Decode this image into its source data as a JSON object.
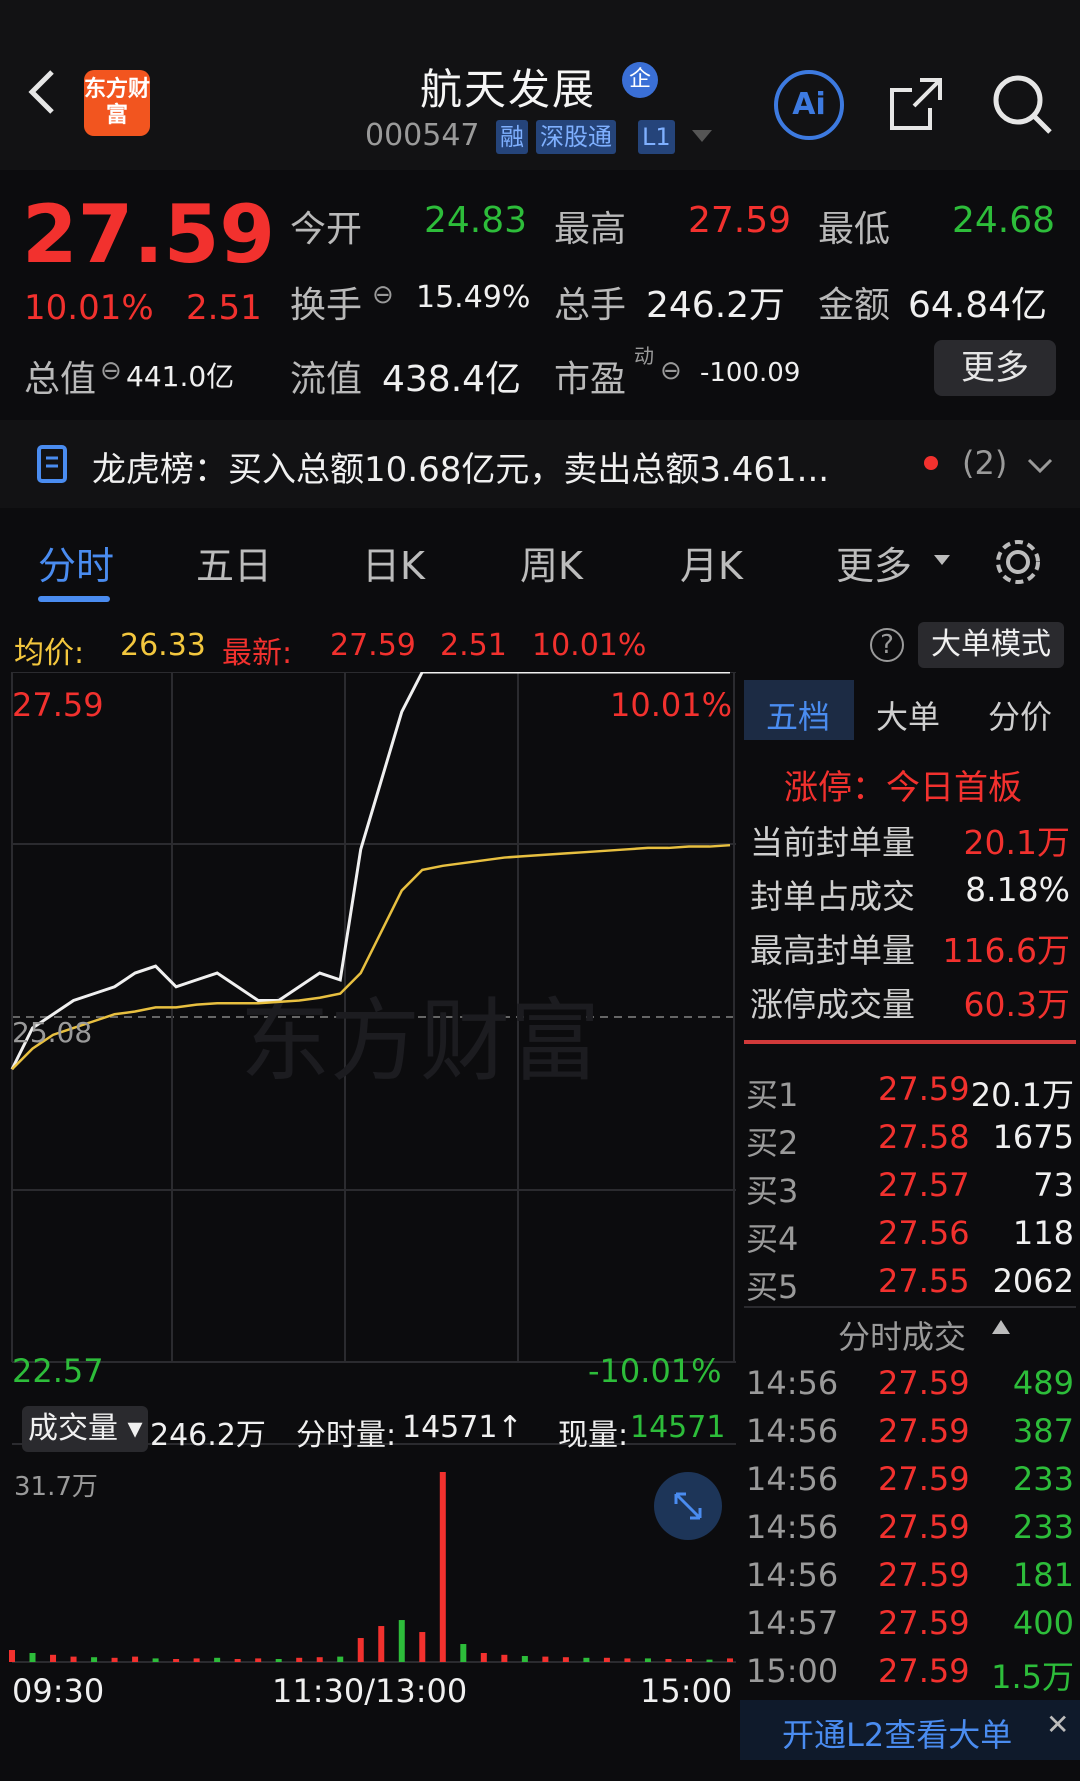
{
  "header": {
    "back_icon": "chevron-left-icon",
    "logo_text": "东方财富",
    "title": "航天发展",
    "qi_badge": "企",
    "code": "000547",
    "tags": [
      "融",
      "深股通",
      "L1"
    ],
    "ai_label": "Ai"
  },
  "quote": {
    "price": "27.59",
    "pct": "10.01%",
    "chg": "2.51",
    "open_label": "今开",
    "open": "24.83",
    "high_label": "最高",
    "high": "27.59",
    "low_label": "最低",
    "low": "24.68",
    "turnover_label": "换手",
    "turnover": "15.49%",
    "volume_label": "总手",
    "volume": "246.2万",
    "amount_label": "金额",
    "amount": "64.84亿",
    "mktcap_label": "总值",
    "mktcap": "441.0亿",
    "float_label": "流值",
    "float": "438.4亿",
    "pe_label": "市盈",
    "pe_sup": "动",
    "pe": "-100.09",
    "more": "更多"
  },
  "lhb": {
    "text": "龙虎榜：买入总额10.68亿元，卖出总额3.461...",
    "count": "(2)"
  },
  "tabs": [
    "分时",
    "五日",
    "日K",
    "周K",
    "月K",
    "更多"
  ],
  "info_bar": {
    "avg_label": "均价:",
    "avg": "26.33",
    "latest_label": "最新:",
    "latest": "27.59",
    "latest_chg": "2.51",
    "latest_pct": "10.01%",
    "mode_btn": "大单模式"
  },
  "chart": {
    "y_top": "27.59",
    "y_mid": "25.08",
    "y_bot": "22.57",
    "pct_top": "10.01%",
    "pct_bot": "-10.01%",
    "x_labels": [
      "09:30",
      "11:30/13:00",
      "15:00"
    ],
    "watermark": "东方财富"
  },
  "volume_bar": {
    "label": "成交量",
    "total": "246.2万",
    "fenshi_label": "分时量:",
    "fenshi": "14571↑",
    "now_label": "现量:",
    "now": "14571",
    "max": "31.7万"
  },
  "right_panel": {
    "tabs": [
      "五档",
      "大单",
      "分价"
    ],
    "limit_title": "涨停：今日首板",
    "stats": [
      {
        "label": "当前封单量",
        "value": "20.1万",
        "color": "red"
      },
      {
        "label": "封单占成交",
        "value": "8.18%",
        "color": "white"
      },
      {
        "label": "最高封单量",
        "value": "116.6万",
        "color": "red"
      },
      {
        "label": "涨停成交量",
        "value": "60.3万",
        "color": "red"
      }
    ],
    "bids": [
      {
        "name": "买1",
        "price": "27.59",
        "qty": "20.1万"
      },
      {
        "name": "买2",
        "price": "27.58",
        "qty": "1675"
      },
      {
        "name": "买3",
        "price": "27.57",
        "qty": "73"
      },
      {
        "name": "买4",
        "price": "27.56",
        "qty": "118"
      },
      {
        "name": "买5",
        "price": "27.55",
        "qty": "2062"
      }
    ],
    "ticks_title": "分时成交",
    "ticks": [
      {
        "time": "14:56",
        "price": "27.59",
        "qty": "489"
      },
      {
        "time": "14:56",
        "price": "27.59",
        "qty": "387"
      },
      {
        "time": "14:56",
        "price": "27.59",
        "qty": "233"
      },
      {
        "time": "14:56",
        "price": "27.59",
        "qty": "233"
      },
      {
        "time": "14:56",
        "price": "27.59",
        "qty": "181"
      },
      {
        "time": "14:57",
        "price": "27.59",
        "qty": "400"
      },
      {
        "time": "15:00",
        "price": "27.59",
        "qty": "1.5万"
      }
    ],
    "l2_banner": "开通L2查看大单"
  },
  "chart_data": {
    "type": "line",
    "y_range": [
      22.57,
      27.59
    ],
    "series": [
      {
        "values": [
          24.7,
          25.0,
          25.1,
          25.2,
          25.25,
          25.3,
          25.4,
          25.45,
          25.3,
          25.35,
          25.4,
          25.3,
          25.2,
          25.2,
          25.3,
          25.4,
          25.35,
          26.3,
          26.8,
          27.3,
          27.59,
          27.59,
          27.59,
          27.59,
          27.59,
          27.59,
          27.59,
          27.59,
          27.59,
          27.59,
          27.59,
          27.59,
          27.59,
          27.59,
          27.59,
          27.59
        ]
      },
      {
        "values": [
          24.7,
          24.85,
          24.95,
          25.0,
          25.05,
          25.1,
          25.12,
          25.15,
          25.15,
          25.17,
          25.18,
          25.18,
          25.18,
          25.19,
          25.2,
          25.22,
          25.25,
          25.4,
          25.7,
          26.0,
          26.15,
          26.18,
          26.2,
          26.22,
          26.24,
          26.25,
          26.26,
          26.27,
          26.28,
          26.29,
          26.3,
          26.31,
          26.31,
          26.32,
          26.32,
          26.33
        ]
      }
    ],
    "volume": {
      "max": 317000,
      "bars": [
        20000,
        15000,
        12000,
        9000,
        8000,
        7000,
        9000,
        6000,
        5000,
        6000,
        7000,
        5000,
        6000,
        5000,
        7000,
        8000,
        9000,
        40000,
        60000,
        70000,
        50000,
        317000,
        30000,
        15000,
        12000,
        10000,
        9000,
        8000,
        7000,
        7000,
        6000,
        6000,
        5000,
        5000,
        4000,
        6000
      ]
    }
  }
}
